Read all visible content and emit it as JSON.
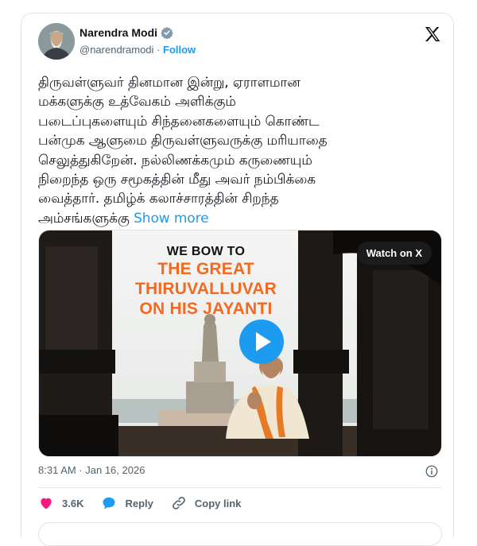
{
  "tweet": {
    "author_name": "Narendra Modi",
    "author_handle": "@narendramodi",
    "separator": "·",
    "follow_label": "Follow",
    "text_lines": [
      "திருவள்ளுவர் தினமான இன்று, ஏராளமான",
      "மக்களுக்கு உத்வேகம் அளிக்கும்",
      "படைப்புகளையும் சிந்தனைகளையும் கொண்ட",
      "பன்முக ஆளுமை திருவள்ளுவருக்கு மரியாதை",
      "செலுத்துகிறேன். நல்லிணக்கமும் கருணையும்",
      "நிறைந்த ஒரு சமூகத்தின் மீது அவர் நம்பிக்கை",
      "வைத்தார். தமிழ்க் கலாச்சாரத்தின் சிறந்த",
      "அம்சங்களுக்கு"
    ],
    "show_more_label": "Show more",
    "timestamp": "8:31 AM · Jan 16, 2026"
  },
  "media": {
    "watch_label": "Watch on X",
    "headline_line1": "WE BOW TO",
    "headline_line2": "THE GREAT",
    "headline_line3": "THIRUVALLUVAR",
    "headline_line4": "ON HIS JAYANTI"
  },
  "actions": {
    "like_count": "3.6K",
    "reply_label": "Reply",
    "copy_link_label": "Copy link"
  },
  "colors": {
    "accent": "#1d9bf0",
    "like": "#f91880",
    "headline_orange": "#f26a21"
  },
  "icons": [
    "verified-badge-icon",
    "x-logo-icon",
    "play-icon",
    "info-icon",
    "heart-icon",
    "reply-icon",
    "link-icon"
  ]
}
